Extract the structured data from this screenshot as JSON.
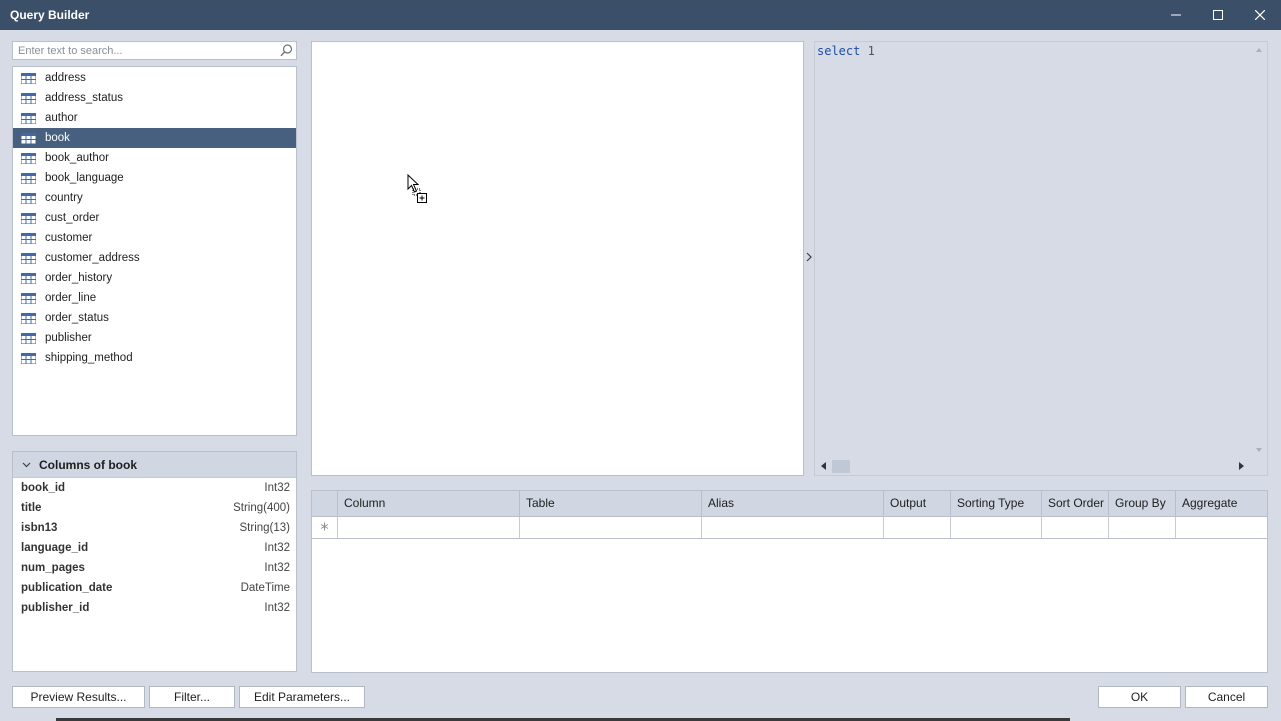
{
  "window": {
    "title": "Query Builder",
    "controls": {
      "minimize": "minimize-icon",
      "maximize": "maximize-icon",
      "close": "close-icon"
    }
  },
  "search": {
    "placeholder": "Enter text to search...",
    "value": "",
    "icon": "search-icon"
  },
  "tables": {
    "icon": "table-icon",
    "selected": "book",
    "items": [
      "address",
      "address_status",
      "author",
      "book",
      "book_author",
      "book_language",
      "country",
      "cust_order",
      "customer",
      "customer_address",
      "order_history",
      "order_line",
      "order_status",
      "publisher",
      "shipping_method"
    ]
  },
  "columns_panel": {
    "title": "Columns of book",
    "columns": [
      {
        "name": "book_id",
        "type": "Int32"
      },
      {
        "name": "title",
        "type": "String(400)"
      },
      {
        "name": "isbn13",
        "type": "String(13)"
      },
      {
        "name": "language_id",
        "type": "Int32"
      },
      {
        "name": "num_pages",
        "type": "Int32"
      },
      {
        "name": "publication_date",
        "type": "DateTime"
      },
      {
        "name": "publisher_id",
        "type": "Int32"
      }
    ]
  },
  "sql": {
    "keyword": "select",
    "value": "1"
  },
  "grid": {
    "columns": [
      "Column",
      "Table",
      "Alias",
      "Output",
      "Sorting Type",
      "Sort Order",
      "Group By",
      "Aggregate"
    ],
    "new_row_icon": "asterisk-icon"
  },
  "buttons": {
    "preview": "Preview Results...",
    "filter": "Filter...",
    "edit_params": "Edit Parameters...",
    "ok": "OK",
    "cancel": "Cancel"
  },
  "colors": {
    "titlebar": "#3b4f68",
    "selected_row": "#47607f",
    "sql_keyword": "#1f4fa3",
    "panel_bg": "#d6dbe6"
  }
}
